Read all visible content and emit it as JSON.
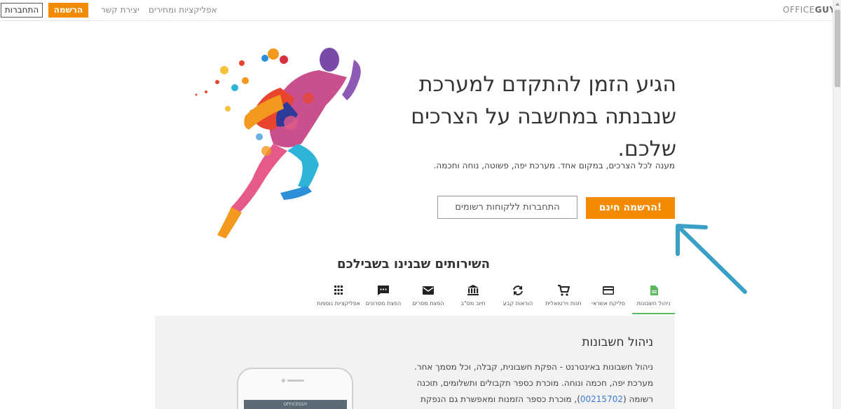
{
  "nav": {
    "login": "התחברות",
    "register": "הרשמה",
    "contact": "יצירת קשר",
    "apps_pricing": "אפליקציות ומחירים",
    "brand_office": "OFFICE",
    "brand_guy": "GUY"
  },
  "hero": {
    "title": "הגיע הזמן להתקדם למערכת שנבנתה במחשבה על הצרכים שלכם.",
    "subtitle": "מענה לכל הצרכים, במקום אחד. מערכת יפה, פשוטה, נוחה וחכמה.",
    "cta_primary": "הרשמה חינם!",
    "cta_secondary": "התחברות ללקוחות רשומים"
  },
  "services": {
    "title": "השירותים שבנינו בשבילכם",
    "tabs": [
      {
        "label": "ניהול חשבונות",
        "icon": "document-icon",
        "active": true
      },
      {
        "label": "סליקת אשראי",
        "icon": "credit-card-icon",
        "active": false
      },
      {
        "label": "חנות וירטואלית",
        "icon": "cart-icon",
        "active": false
      },
      {
        "label": "הוראות קבע",
        "icon": "refresh-icon",
        "active": false
      },
      {
        "label": "חיוב מס\"ב",
        "icon": "bank-icon",
        "active": false
      },
      {
        "label": "הפצת מסרים",
        "icon": "email-icon",
        "active": false
      },
      {
        "label": "הפצת מסרונים",
        "icon": "sms-icon",
        "active": false
      },
      {
        "label": "אפליקציות נוספות",
        "icon": "grid-icon",
        "active": false
      }
    ]
  },
  "panel": {
    "title": "ניהול חשבונות",
    "line1": "ניהול חשבונות באינטרנט - הפקת חשבונית, קבלה, וכל מסמך אחר.",
    "line2": "מערכת יפה, חכמה ונוחה. מוכרת כספר תקבולים ותשלומים, תוכנה",
    "line3_pre": "רשומה (",
    "line3_link": "00215702",
    "line3_post": "), מוכרת כספר הזמנות ומאפשרת גם הנפקת"
  },
  "phone": {
    "brand": "OFFICEGUY"
  },
  "colors": {
    "accent": "#f38b00",
    "active_tab": "#5cb85c",
    "arrow": "#3aa0c6"
  }
}
